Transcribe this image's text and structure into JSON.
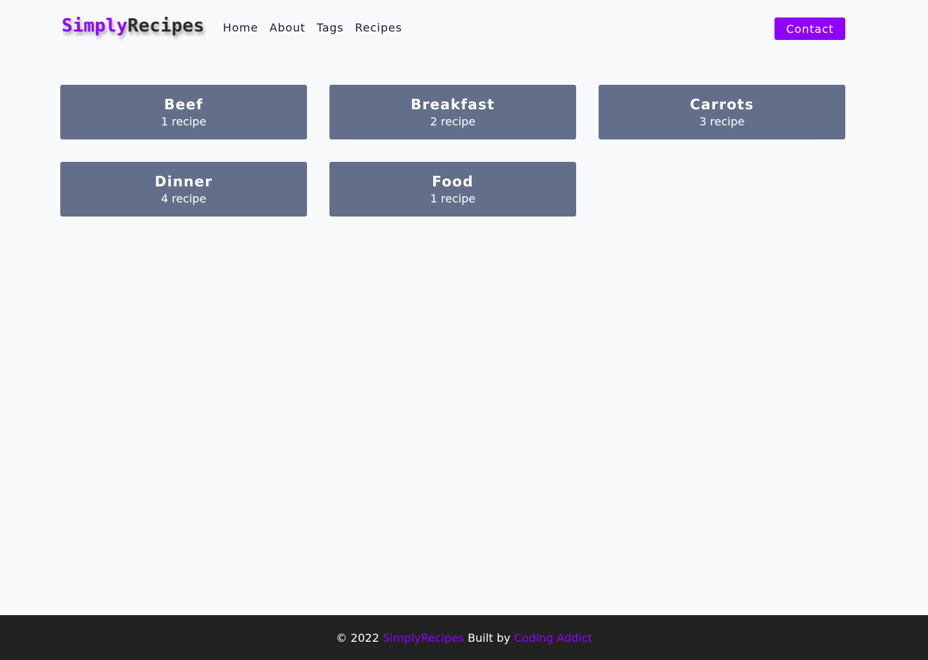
{
  "header": {
    "logo_part1": "Simply",
    "logo_part2": "Recipes",
    "nav": [
      "Home",
      "About",
      "Tags",
      "Recipes"
    ],
    "contact_label": "Contact"
  },
  "tags": [
    {
      "name": "Beef",
      "count": "1 recipe"
    },
    {
      "name": "Breakfast",
      "count": "2 recipe"
    },
    {
      "name": "Carrots",
      "count": "3 recipe"
    },
    {
      "name": "Dinner",
      "count": "4 recipe"
    },
    {
      "name": "Food",
      "count": "1 recipe"
    }
  ],
  "footer": {
    "copyright": "© 2022",
    "brand": "SimplyRecipes",
    "built_by": "Built by",
    "author": "Coding Addict"
  },
  "colors": {
    "accent": "#8f00ff",
    "card": "#636f8a",
    "footer_bg": "#222222",
    "page_bg": "#f8f9fb"
  }
}
